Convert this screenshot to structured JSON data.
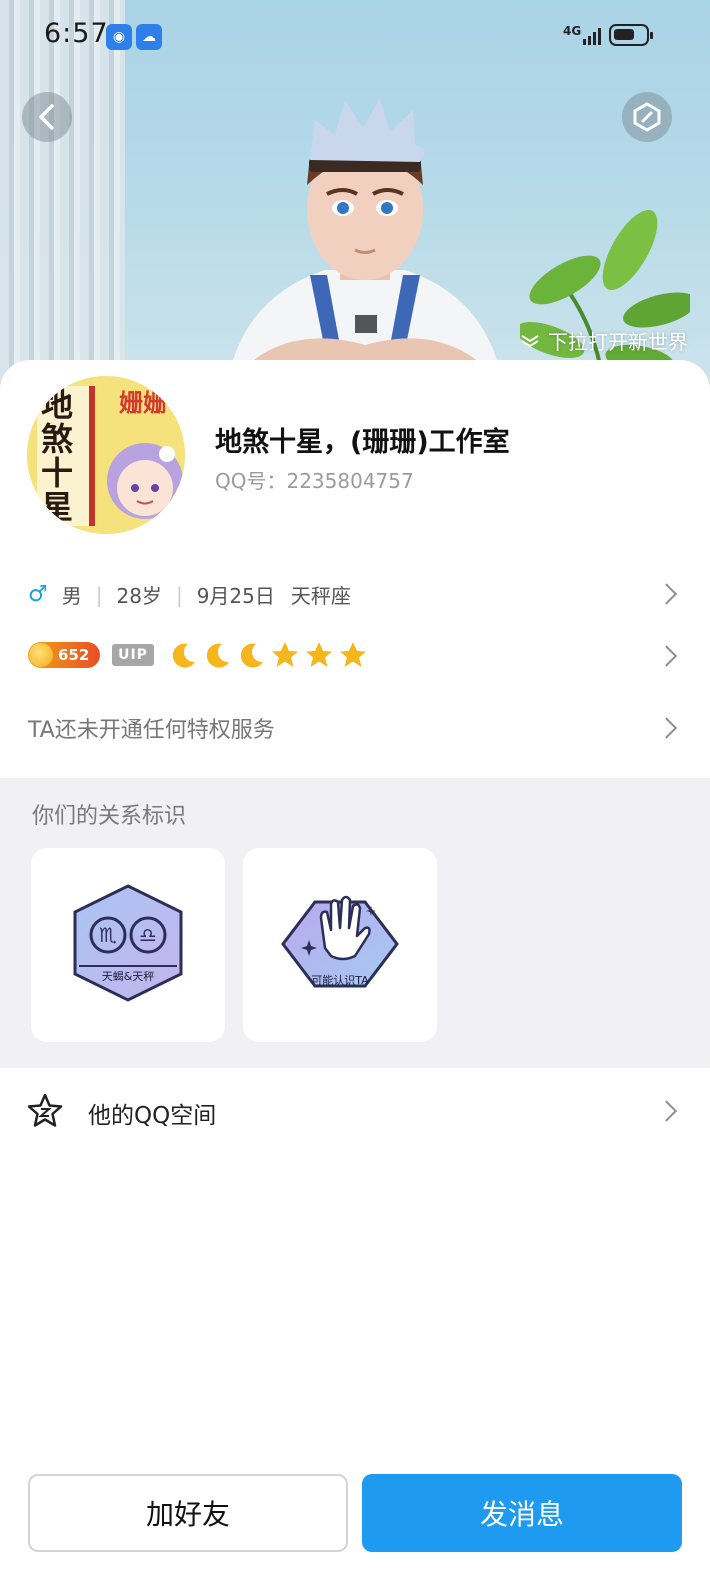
{
  "status_bar": {
    "time": "6:57",
    "network": "4G"
  },
  "banner": {
    "pull_hint": "下拉打开新世界"
  },
  "profile": {
    "nickname": "地煞十星，(珊珊)工作室",
    "qq_label": "QQ号：",
    "qq_number": "2235804757",
    "avatar_text": {
      "vertical": "地煞十星",
      "side": "姗姗"
    }
  },
  "info": {
    "gender": "男",
    "age": "28岁",
    "birthday": "9月25日",
    "constellation": "天秤座"
  },
  "level": {
    "coin_value": "652",
    "vip_label": "UIP",
    "moons": 3,
    "stars": 3
  },
  "privilege": {
    "text": "TA还未开通任何特权服务"
  },
  "relations": {
    "title": "你们的关系标识",
    "items": [
      {
        "label": "天蝎&天秤",
        "icon": "zodiac-badge-icon"
      },
      {
        "label": "可能认识TA",
        "icon": "wave-hand-badge-icon"
      }
    ]
  },
  "space": {
    "label": "他的QQ空间",
    "icon": "qzone-star-icon"
  },
  "actions": {
    "add_friend": "加好友",
    "send_message": "发消息"
  },
  "colors": {
    "primary_button": "#1e9bf0",
    "male": "#1aa1d8"
  }
}
